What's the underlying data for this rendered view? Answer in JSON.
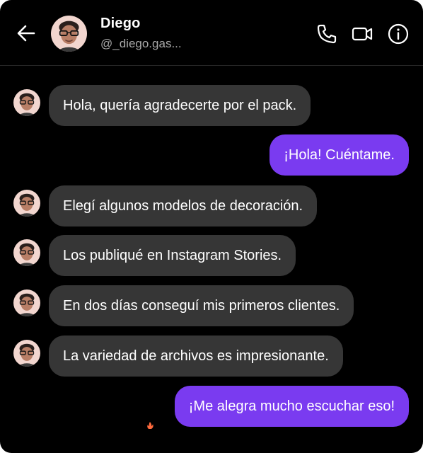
{
  "contact": {
    "name": "Diego",
    "username": "@_diego.gas..."
  },
  "header_icons": [
    "back-arrow-icon",
    "phone-icon",
    "video-camera-icon",
    "info-icon"
  ],
  "colors": {
    "background": "#000000",
    "incoming_bubble": "#363636",
    "outgoing_bubble": "#7a3bf0",
    "username_text": "#a8a8a8"
  },
  "messages": [
    {
      "direction": "in",
      "text": "Hola, quería agradecerte por el pack."
    },
    {
      "direction": "out",
      "text": "¡Hola! Cuéntame."
    },
    {
      "direction": "in",
      "text": "Elegí algunos modelos de decoración."
    },
    {
      "direction": "in",
      "text": "Los publiqué en Instagram Stories."
    },
    {
      "direction": "in",
      "text": "En dos días conseguí mis primeros clientes."
    },
    {
      "direction": "in",
      "text": "La variedad de archivos es impresionante."
    },
    {
      "direction": "out",
      "text": "¡Me alegra mucho escuchar eso!"
    }
  ]
}
